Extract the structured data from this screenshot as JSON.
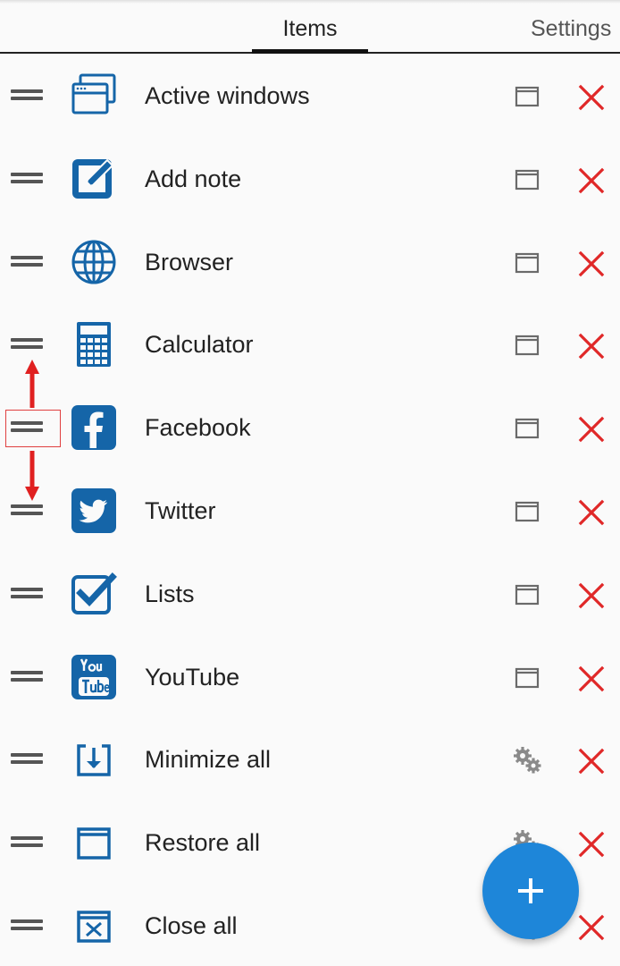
{
  "tabs": [
    {
      "label": "Items",
      "selected": true
    },
    {
      "label": "Settings",
      "selected": false
    }
  ],
  "items": [
    {
      "label": "Active windows",
      "icon": "active-windows-icon",
      "action": "window-mode-icon"
    },
    {
      "label": "Add note",
      "icon": "add-note-icon",
      "action": "window-mode-icon"
    },
    {
      "label": "Browser",
      "icon": "globe-icon",
      "action": "window-mode-icon"
    },
    {
      "label": "Calculator",
      "icon": "calculator-icon",
      "action": "window-mode-icon"
    },
    {
      "label": "Facebook",
      "icon": "facebook-icon",
      "action": "window-mode-icon"
    },
    {
      "label": "Twitter",
      "icon": "twitter-icon",
      "action": "window-mode-icon"
    },
    {
      "label": "Lists",
      "icon": "checkbox-icon",
      "action": "window-mode-icon"
    },
    {
      "label": "YouTube",
      "icon": "youtube-icon",
      "action": "window-mode-icon"
    },
    {
      "label": "Minimize all",
      "icon": "minimize-all-icon",
      "action": "settings-gear-icon"
    },
    {
      "label": "Restore all",
      "icon": "restore-all-icon",
      "action": "settings-gear-icon"
    },
    {
      "label": "Close all",
      "icon": "close-all-icon",
      "action": "settings-gear-icon"
    }
  ],
  "colors": {
    "accent": "#1e86d9",
    "icon_blue": "#1565a8",
    "delete_red": "#e02828",
    "annotation_red": "#e04040"
  },
  "fab": {
    "icon": "plus-icon"
  }
}
